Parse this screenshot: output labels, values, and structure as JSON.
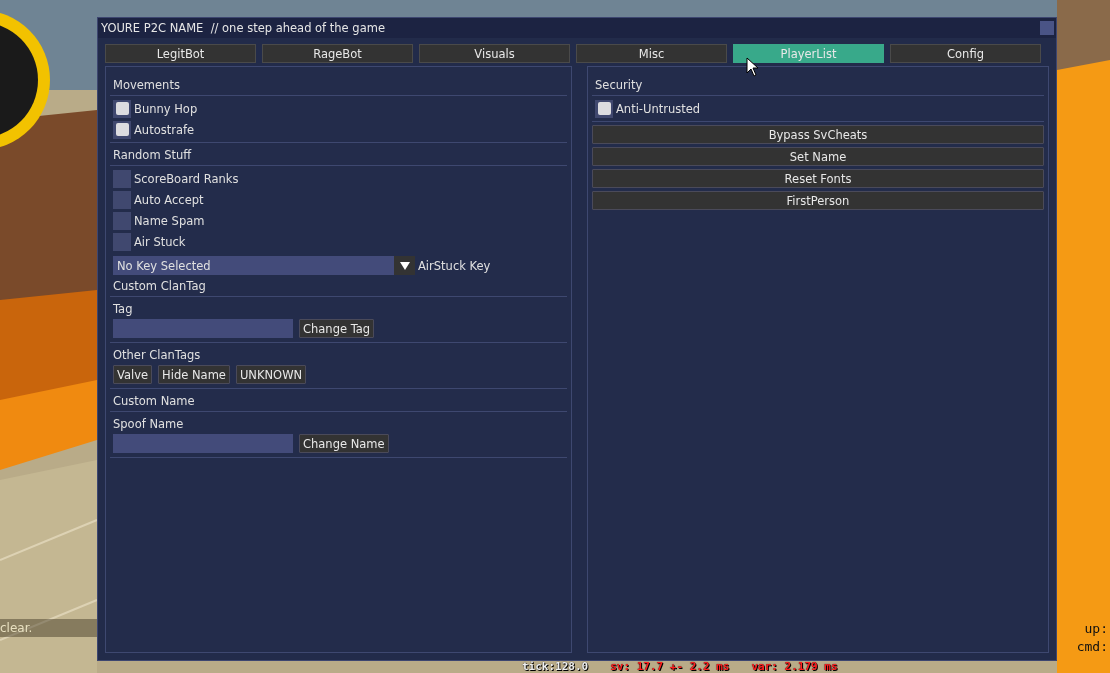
{
  "window": {
    "title": "YOURE P2C NAME  // one step ahead of the game"
  },
  "tabs": [
    {
      "label": "LegitBot",
      "selected": false
    },
    {
      "label": "RageBot",
      "selected": false
    },
    {
      "label": "Visuals",
      "selected": false
    },
    {
      "label": "Misc",
      "selected": false
    },
    {
      "label": "PlayerList",
      "selected": true
    },
    {
      "label": "Config",
      "selected": false
    }
  ],
  "left_panel": {
    "items": [
      {
        "kind": "heading",
        "text": "Movements"
      },
      {
        "kind": "separator"
      },
      {
        "kind": "checkbox",
        "label": "Bunny Hop",
        "checked": true
      },
      {
        "kind": "checkbox",
        "label": "Autostrafe",
        "checked": true
      },
      {
        "kind": "separator"
      },
      {
        "kind": "heading",
        "text": "Random Stuff"
      },
      {
        "kind": "separator"
      },
      {
        "kind": "checkbox",
        "label": "ScoreBoard Ranks",
        "checked": false
      },
      {
        "kind": "checkbox",
        "label": "Auto Accept",
        "checked": false
      },
      {
        "kind": "checkbox",
        "label": "Name Spam",
        "checked": false
      },
      {
        "kind": "checkbox",
        "label": "Air Stuck",
        "checked": false
      },
      {
        "kind": "combo",
        "selection": "No Key Selected",
        "caption": "AirStuck Key"
      },
      {
        "kind": "heading",
        "text": "Custom ClanTag"
      },
      {
        "kind": "separator"
      },
      {
        "kind": "heading",
        "text": "Tag"
      },
      {
        "kind": "input",
        "button": "Change Tag"
      },
      {
        "kind": "separator"
      },
      {
        "kind": "heading",
        "text": "Other ClanTags"
      },
      {
        "kind": "buttons",
        "buttons": [
          "Valve",
          "Hide Name",
          "UNKNOWN"
        ]
      },
      {
        "kind": "separator"
      },
      {
        "kind": "heading",
        "text": "Custom Name"
      },
      {
        "kind": "separator"
      },
      {
        "kind": "heading",
        "text": "Spoof Name"
      },
      {
        "kind": "input",
        "button": "Change Name"
      },
      {
        "kind": "separator"
      }
    ]
  },
  "right_panel": {
    "items": [
      {
        "kind": "heading",
        "text": "Security"
      },
      {
        "kind": "separator"
      },
      {
        "kind": "checkbox",
        "label": "Anti-Untrusted",
        "checked": true
      },
      {
        "kind": "separator"
      },
      {
        "kind": "wide_button",
        "label": "Bypass SvCheats"
      },
      {
        "kind": "wide_button",
        "label": "Set Name"
      },
      {
        "kind": "wide_button",
        "label": "Reset Fonts"
      },
      {
        "kind": "wide_button",
        "label": "FirstPerson"
      }
    ]
  },
  "hud": {
    "console_line": "clear.",
    "netgraph": {
      "tick": "tick:128.0",
      "sv": "sv:  17.7 +- 2.2 ms",
      "var": "var:  2.179 ms"
    },
    "right_labels": [
      "up:",
      "cmd:"
    ]
  }
}
